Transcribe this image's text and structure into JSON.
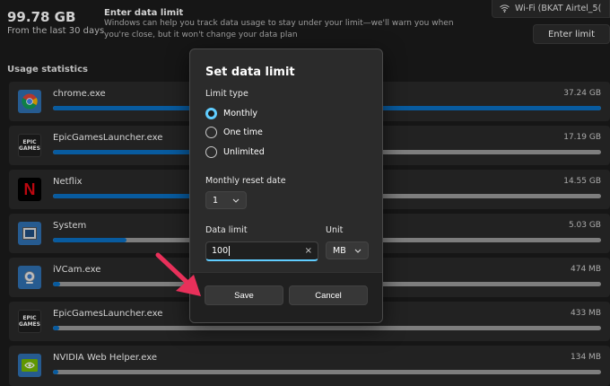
{
  "header": {
    "total_usage": "99.78 GB",
    "period": "From the last 30 days",
    "enter_limit_title": "Enter data limit",
    "enter_limit_desc": "Windows can help you track data usage to stay under your limit—we'll warn you when you're close, but it won't change your data plan",
    "network_name": "Wi-Fi (BKAT Airtel_5(",
    "enter_limit_button": "Enter limit"
  },
  "usage": {
    "title": "Usage statistics",
    "apps": [
      {
        "name": "chrome.exe",
        "size": "37.24 GB",
        "fraction": 1.0
      },
      {
        "name": "EpicGamesLauncher.exe",
        "size": "17.19 GB",
        "fraction": 0.46
      },
      {
        "name": "Netflix",
        "size": "14.55 GB",
        "fraction": 0.39
      },
      {
        "name": "System",
        "size": "5.03 GB",
        "fraction": 0.135
      },
      {
        "name": "iVCam.exe",
        "size": "474 MB",
        "fraction": 0.013
      },
      {
        "name": "EpicGamesLauncher.exe",
        "size": "433 MB",
        "fraction": 0.012
      },
      {
        "name": "NVIDIA Web Helper.exe",
        "size": "134 MB",
        "fraction": 0.004
      }
    ],
    "epic_logo": "EPIC GAMES",
    "netflix_logo": "N"
  },
  "dialog": {
    "title": "Set data limit",
    "limit_type_label": "Limit type",
    "options": [
      "Monthly",
      "One time",
      "Unlimited"
    ],
    "selected_option": "Monthly",
    "reset_date_label": "Monthly reset date",
    "reset_date_value": "1",
    "data_limit_label": "Data limit",
    "data_limit_value": "100",
    "unit_label": "Unit",
    "unit_value": "MB",
    "clear_glyph": "×",
    "save_button": "Save",
    "cancel_button": "Cancel"
  },
  "colors": {
    "accent": "#60cdff",
    "bar_fill": "#0a6fc2",
    "arrow": "#e8305a"
  }
}
